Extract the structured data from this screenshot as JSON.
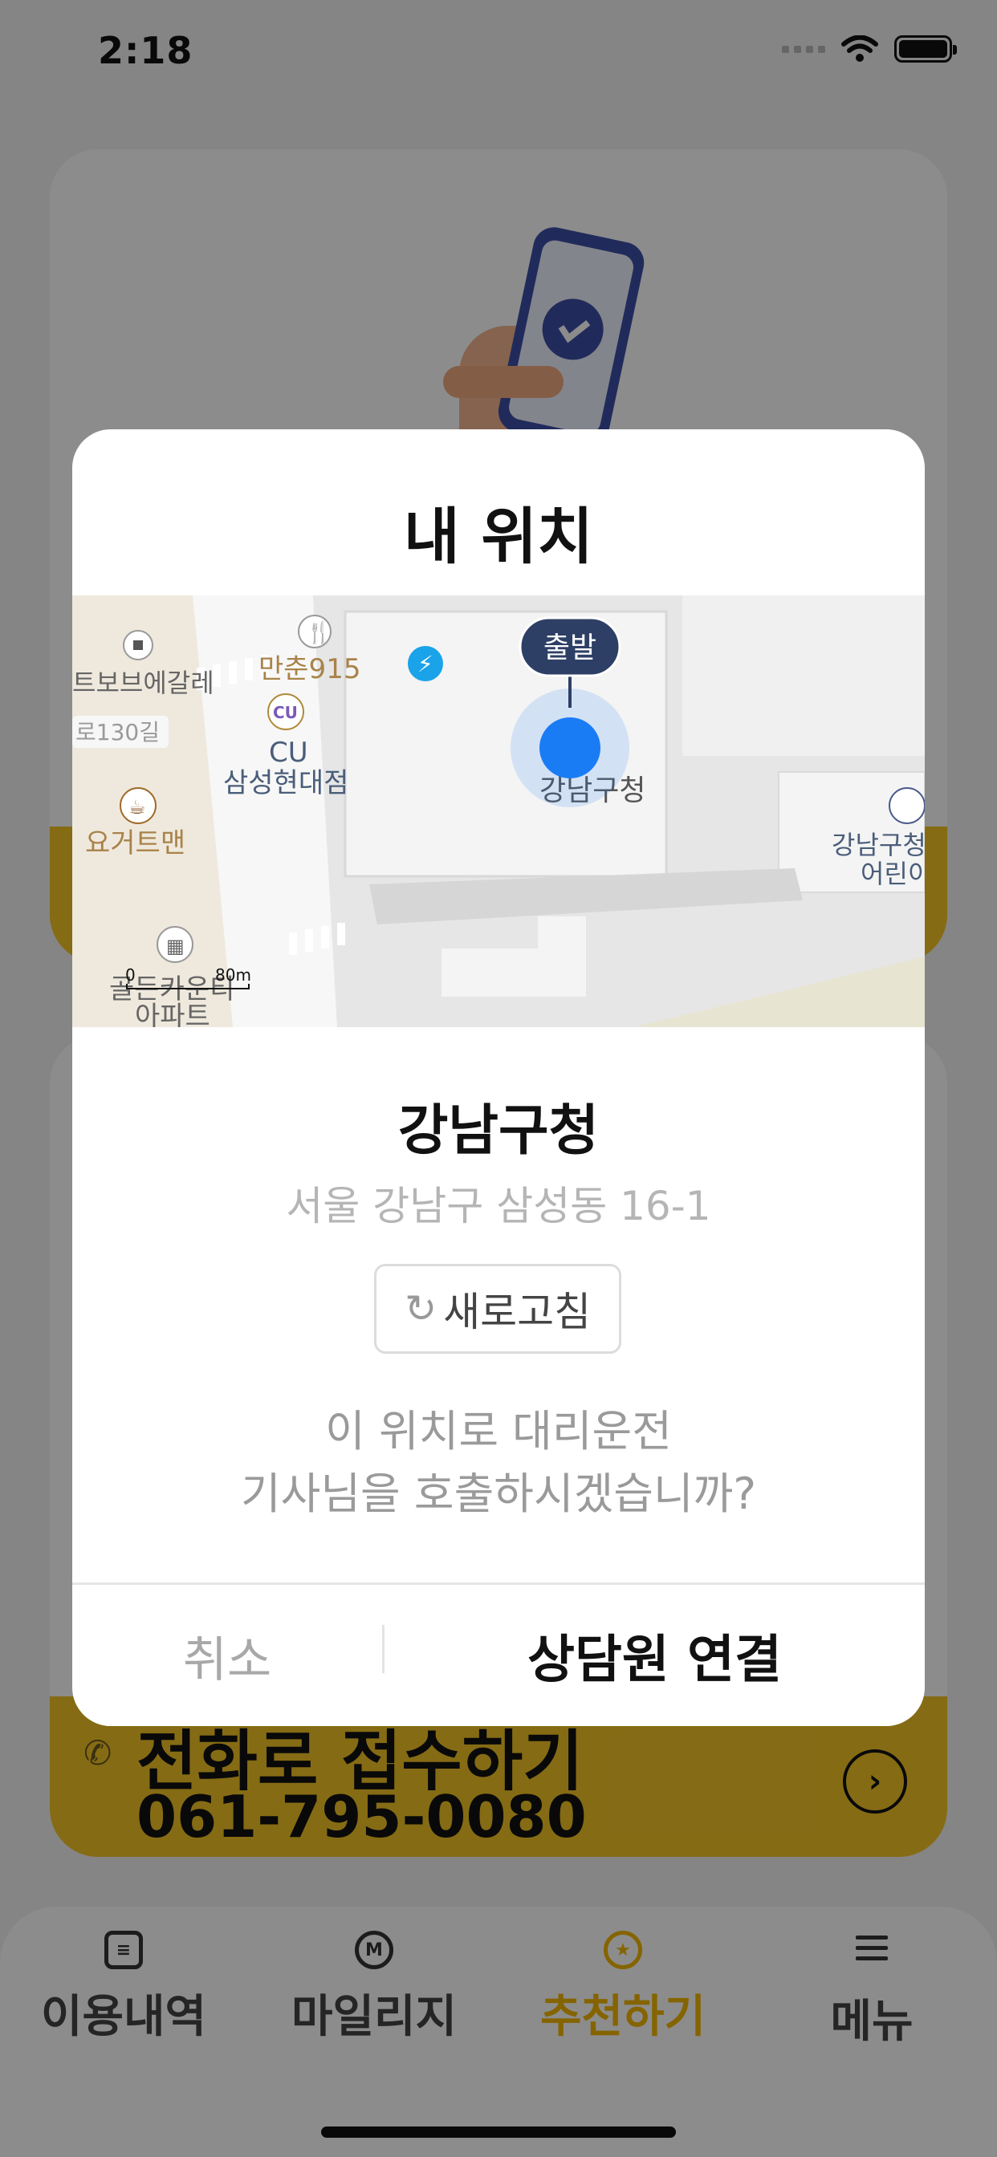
{
  "status_bar": {
    "time": "2:18"
  },
  "background": {
    "call_card": {
      "title": "전화로 접수하기",
      "phone_number": "061-795-0080"
    }
  },
  "tab_bar": {
    "items": [
      {
        "label": "이용내역",
        "icon": "document-icon",
        "active": false
      },
      {
        "label": "마일리지",
        "icon": "mileage-icon",
        "active": false,
        "icon_glyph": "M"
      },
      {
        "label": "추천하기",
        "icon": "recommend-star-icon",
        "active": true,
        "icon_glyph": "★"
      },
      {
        "label": "메뉴",
        "icon": "hamburger-menu-icon",
        "active": false
      }
    ]
  },
  "modal": {
    "title": "내 위치",
    "map": {
      "marker_label": "출발",
      "scale_start": "0",
      "scale_end": "80m",
      "pois": [
        {
          "name": "트보브에갈레"
        },
        {
          "name": "만춘915"
        },
        {
          "name": "CU"
        },
        {
          "name": "삼성현대점"
        },
        {
          "name": "강남구청"
        },
        {
          "name": "요거트맨"
        },
        {
          "name": "골든카운티"
        },
        {
          "name": "아파트"
        },
        {
          "name": "강남구청"
        },
        {
          "name": "어린이"
        }
      ],
      "road_label": "로130길",
      "cu_badge": "CU"
    },
    "place_name": "강남구청",
    "address": "서울 강남구 삼성동 16-1",
    "refresh_label": "새로고침",
    "confirm_line1": "이 위치로 대리운전",
    "confirm_line2": "기사님을 호출하시겠습니까?",
    "cancel_label": "취소",
    "connect_label": "상담원 연결"
  },
  "colors": {
    "accent_yellow": "#f3c326",
    "marker_blue": "#1a7cf5",
    "marker_label_bg": "#2e3f66"
  }
}
